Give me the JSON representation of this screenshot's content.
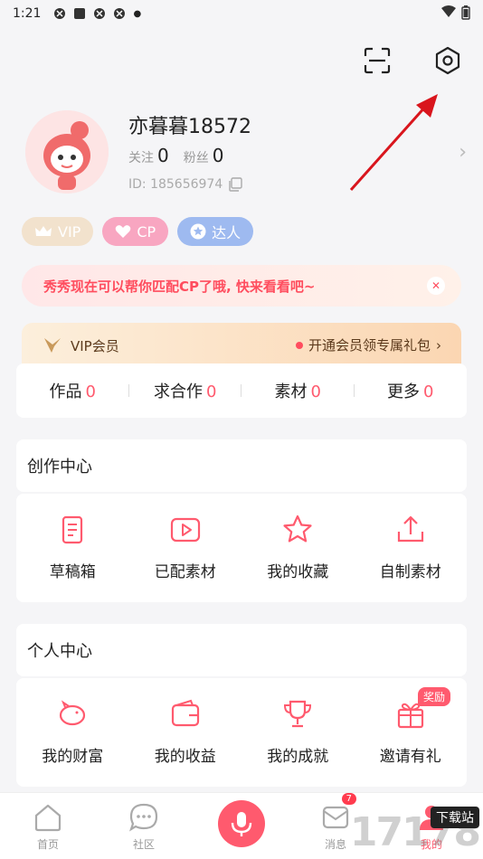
{
  "status_bar": {
    "time": "1:21"
  },
  "profile": {
    "username": "亦暮暮18572",
    "following_label": "关注",
    "following_count": "0",
    "fans_label": "粉丝",
    "fans_count": "0",
    "id_text": "ID: 185656974"
  },
  "badges": [
    {
      "label": "VIP",
      "icon": "crown-icon"
    },
    {
      "label": "CP",
      "icon": "heart-icon"
    },
    {
      "label": "达人",
      "icon": "star-icon"
    }
  ],
  "promo_banner": {
    "text": "秀秀现在可以帮你匹配CP了哦, 快来看看吧~"
  },
  "vip_bar": {
    "left_label": "VIP会员",
    "right_label": "开通会员领专属礼包"
  },
  "content_tabs": [
    {
      "label": "作品",
      "count": "0"
    },
    {
      "label": "求合作",
      "count": "0"
    },
    {
      "label": "素材",
      "count": "0"
    },
    {
      "label": "更多",
      "count": "0"
    }
  ],
  "creation_center": {
    "title": "创作中心",
    "items": [
      {
        "label": "草稿箱",
        "icon": "draft-icon"
      },
      {
        "label": "已配素材",
        "icon": "play-icon"
      },
      {
        "label": "我的收藏",
        "icon": "star-icon"
      },
      {
        "label": "自制素材",
        "icon": "upload-icon"
      }
    ]
  },
  "personal_center": {
    "title": "个人中心",
    "items": [
      {
        "label": "我的财富",
        "icon": "piggy-bank-icon"
      },
      {
        "label": "我的收益",
        "icon": "wallet-icon"
      },
      {
        "label": "我的成就",
        "icon": "trophy-icon"
      },
      {
        "label": "邀请有礼",
        "icon": "gift-icon",
        "tag": "奖励"
      }
    ]
  },
  "tab_bar": {
    "items": [
      {
        "label": "首页",
        "icon": "home-icon"
      },
      {
        "label": "社区",
        "icon": "chat-icon"
      },
      {
        "label": "",
        "icon": "mic-icon"
      },
      {
        "label": "消息",
        "icon": "message-icon",
        "badge": "7"
      },
      {
        "label": "我的",
        "icon": "user-icon"
      }
    ]
  },
  "watermark": {
    "text": "17178",
    "tag": "下载站"
  },
  "colors": {
    "accent": "#ff5a6e",
    "background": "#f5f5f7"
  }
}
